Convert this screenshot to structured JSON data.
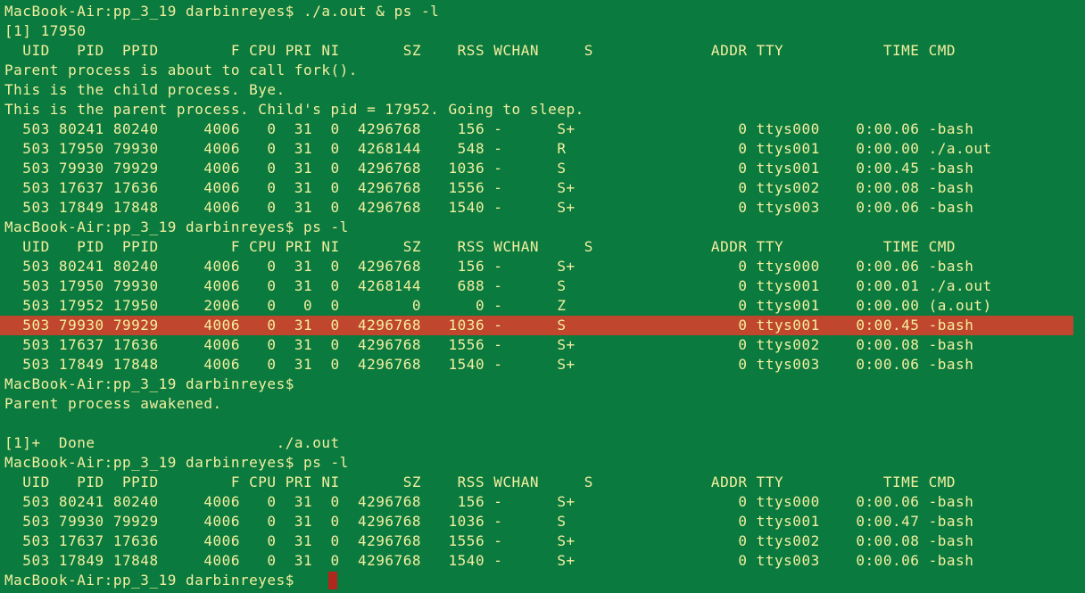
{
  "terminal": {
    "background_color": "#0a7a3f",
    "text_color": "#f3ef9f",
    "highlight_color": "#c0462d",
    "cursor_color": "#b0271b",
    "highlighted_line_index": 16,
    "lines": [
      "MacBook-Air:pp_3_19 darbinreyes$ ./a.out & ps -l",
      "[1] 17950",
      "  UID   PID  PPID        F CPU PRI NI       SZ    RSS WCHAN     S             ADDR TTY           TIME CMD",
      "Parent process is about to call fork().",
      "This is the child process. Bye.",
      "This is the parent process. Child's pid = 17952. Going to sleep.",
      "  503 80241 80240     4006   0  31  0  4296768    156 -      S+                  0 ttys000    0:00.06 -bash",
      "  503 17950 79930     4006   0  31  0  4268144    548 -      R                   0 ttys001    0:00.00 ./a.out",
      "  503 79930 79929     4006   0  31  0  4296768   1036 -      S                   0 ttys001    0:00.45 -bash",
      "  503 17637 17636     4006   0  31  0  4296768   1556 -      S+                  0 ttys002    0:00.08 -bash",
      "  503 17849 17848     4006   0  31  0  4296768   1540 -      S+                  0 ttys003    0:00.06 -bash",
      "MacBook-Air:pp_3_19 darbinreyes$ ps -l",
      "  UID   PID  PPID        F CPU PRI NI       SZ    RSS WCHAN     S             ADDR TTY           TIME CMD",
      "  503 80241 80240     4006   0  31  0  4296768    156 -      S+                  0 ttys000    0:00.06 -bash",
      "  503 17950 79930     4006   0  31  0  4268144    688 -      S                   0 ttys001    0:00.01 ./a.out",
      "  503 17952 17950     2006   0   0  0        0      0 -      Z                   0 ttys001    0:00.00 (a.out)",
      "  503 79930 79929     4006   0  31  0  4296768   1036 -      S                   0 ttys001    0:00.45 -bash",
      "  503 17637 17636     4006   0  31  0  4296768   1556 -      S+                  0 ttys002    0:00.08 -bash",
      "  503 17849 17848     4006   0  31  0  4296768   1540 -      S+                  0 ttys003    0:00.06 -bash",
      "MacBook-Air:pp_3_19 darbinreyes$",
      "Parent process awakened.",
      "",
      "[1]+  Done                    ./a.out",
      "MacBook-Air:pp_3_19 darbinreyes$ ps -l",
      "  UID   PID  PPID        F CPU PRI NI       SZ    RSS WCHAN     S             ADDR TTY           TIME CMD",
      "  503 80241 80240     4006   0  31  0  4296768    156 -      S+                  0 ttys000    0:00.06 -bash",
      "  503 79930 79929     4006   0  31  0  4296768   1036 -      S                   0 ttys001    0:00.47 -bash",
      "  503 17637 17636     4006   0  31  0  4296768   1556 -      S+                  0 ttys002    0:00.08 -bash",
      "  503 17849 17848     4006   0  31  0  4296768   1540 -      S+                  0 ttys003    0:00.06 -bash",
      "MacBook-Air:pp_3_19 darbinreyes$ "
    ]
  }
}
